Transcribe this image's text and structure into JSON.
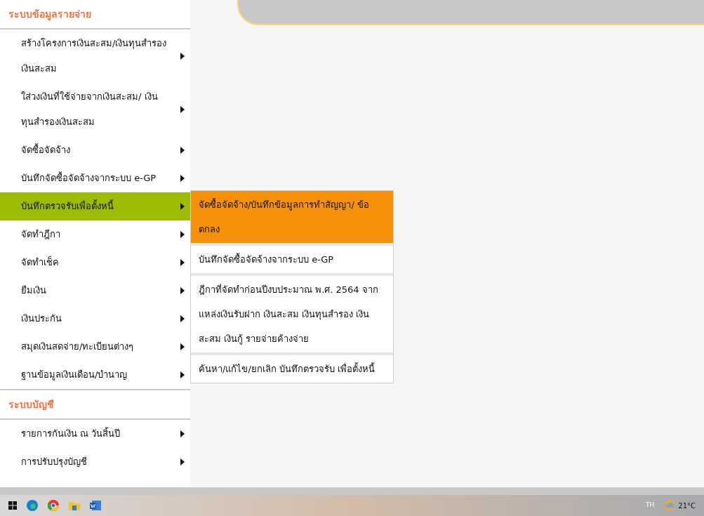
{
  "sections": [
    {
      "title": "ระบบข้อมูลรายจ่าย",
      "items": [
        {
          "label": "สร้างโครงการเงินสะสม/เงินทุนสำรอง เงินสะสม",
          "selected": false
        },
        {
          "label": "ใส่วงเงินที่ใช้จ่ายจากเงินสะสม/ เงินทุนสำรองเงินสะสม",
          "selected": false
        },
        {
          "label": "จัดซื้อจัดจ้าง",
          "selected": false
        },
        {
          "label": "บันทึกจัดซื้อจัดจ้างจากระบบ e-GP",
          "selected": false
        },
        {
          "label": "บันทึกตรวจรับเพื่อตั้งหนี้",
          "selected": true
        },
        {
          "label": "จัดทำฎีกา",
          "selected": false
        },
        {
          "label": "จัดทำเช็ค",
          "selected": false
        },
        {
          "label": "ยืมเงิน",
          "selected": false
        },
        {
          "label": "เงินประกัน",
          "selected": false
        },
        {
          "label": "สมุดเงินสดจ่าย/ทะเบียนต่างๆ",
          "selected": false
        },
        {
          "label": "ฐานข้อมูลเงินเดือน/บำนาญ",
          "selected": false
        }
      ]
    },
    {
      "title": "ระบบบัญชี",
      "items": [
        {
          "label": "รายการกันเงิน ณ วันสิ้นปี",
          "selected": false
        },
        {
          "label": "การปรับปรุงบัญชี",
          "selected": false
        }
      ]
    }
  ],
  "submenu": [
    {
      "label": "จัดซื้อจัดจ้าง/บันทึกข้อมูลการทำสัญญา/ ข้อตกลง",
      "selected": true
    },
    {
      "label": "บันทึกจัดซื้อจัดจ้างจากระบบ e-GP",
      "selected": false
    },
    {
      "label": "ฎีกาที่จัดทำก่อนปีงบประมาณ พ.ศ. 2564 จากแหล่งเงินรับฝาก เงินสะสม เงินทุนสำรอง เงินสะสม เงินกู้ รายจ่ายค้างจ่าย",
      "selected": false
    },
    {
      "label": "ค้นหา/แก้ไข/ยกเลิก บันทึกตรวจรับ เพื่อตั้งหนี้",
      "selected": false
    }
  ],
  "taskbar": {
    "language": "TH",
    "weather": "21°C"
  }
}
